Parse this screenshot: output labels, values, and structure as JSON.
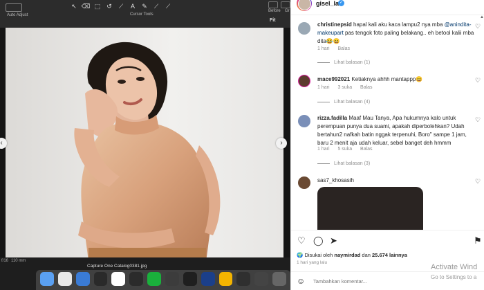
{
  "editor": {
    "auto_adjust": "Auto Adjust",
    "cursor_tools": "Cursor Tools",
    "before": "Before",
    "g_truncated": "Gr",
    "fit": "Fit",
    "status_left": "f/16",
    "status_focal": "110 mm",
    "catalog_file": "Capture One Catalog0381.jpg",
    "tools": [
      "↖",
      "⌫",
      "⬚",
      "↺",
      "⟋",
      "A",
      "✎",
      "⟋",
      "⟋"
    ],
    "dock_colors": [
      "#5aa0f2",
      "#e8e8e8",
      "#3a7bd5",
      "#2a2a2a",
      "#ffffff",
      "#2b2b2b",
      "#1ab03c",
      "#3c3c3c",
      "#1f1f1f",
      "#1b3f8a",
      "#f4b400",
      "#2f2f2f",
      "#444444",
      "#666666"
    ]
  },
  "post": {
    "username": "gisel_la",
    "verified": "✓"
  },
  "comments": [
    {
      "user": "christinepsid",
      "text_before": "hapal kali aku kaca lampu2 nya mba ",
      "mention": "@anindita­makeupart",
      "text_after": " pas tengok foto paling belakang.. eh betool kalii mba dita😂😄",
      "time": "1 hari",
      "reply": "Balas",
      "replies": "Lihat balasan (1)",
      "avatar_color": "#9aa8b4"
    },
    {
      "user": "mace992021",
      "text": "Ketiaknya ahhh mantappp😄",
      "time": "1 hari",
      "likes": "3 suka",
      "reply": "Balas",
      "replies": "Lihat balasan (4)",
      "avatar_color": "#5c3b2e"
    },
    {
      "user": "rizza.fadilla",
      "text": "Maaf Mau Tanya, Apa hukumnya kalo untuk perempuan punya dua suami, apakah diperbolehkan? Udah bertahun2 nafkah batin nggak terpenuhi, Boro\" sampe 1 jam, baru 2 menit aja udah keluar, sebel banget deh hmmm",
      "time": "1 hari",
      "likes": "5 suka",
      "reply": "Balas",
      "replies": "Lihat balasan (3)",
      "avatar_color": "#7a8fb8"
    },
    {
      "user": "sas7_khosasih",
      "avatar_color": "#6a4a33"
    }
  ],
  "likes_prefix": "Disukai oleh ",
  "likes_user": "naymirdad",
  "likes_and": " dan ",
  "likes_count": "25.674 lainnya",
  "time_ago": "1 hari yang lalu",
  "comment_placeholder": "Tambahkan komentar...",
  "watermark": {
    "line1": "Activate Wind",
    "line2": "Go to Settings to a"
  }
}
